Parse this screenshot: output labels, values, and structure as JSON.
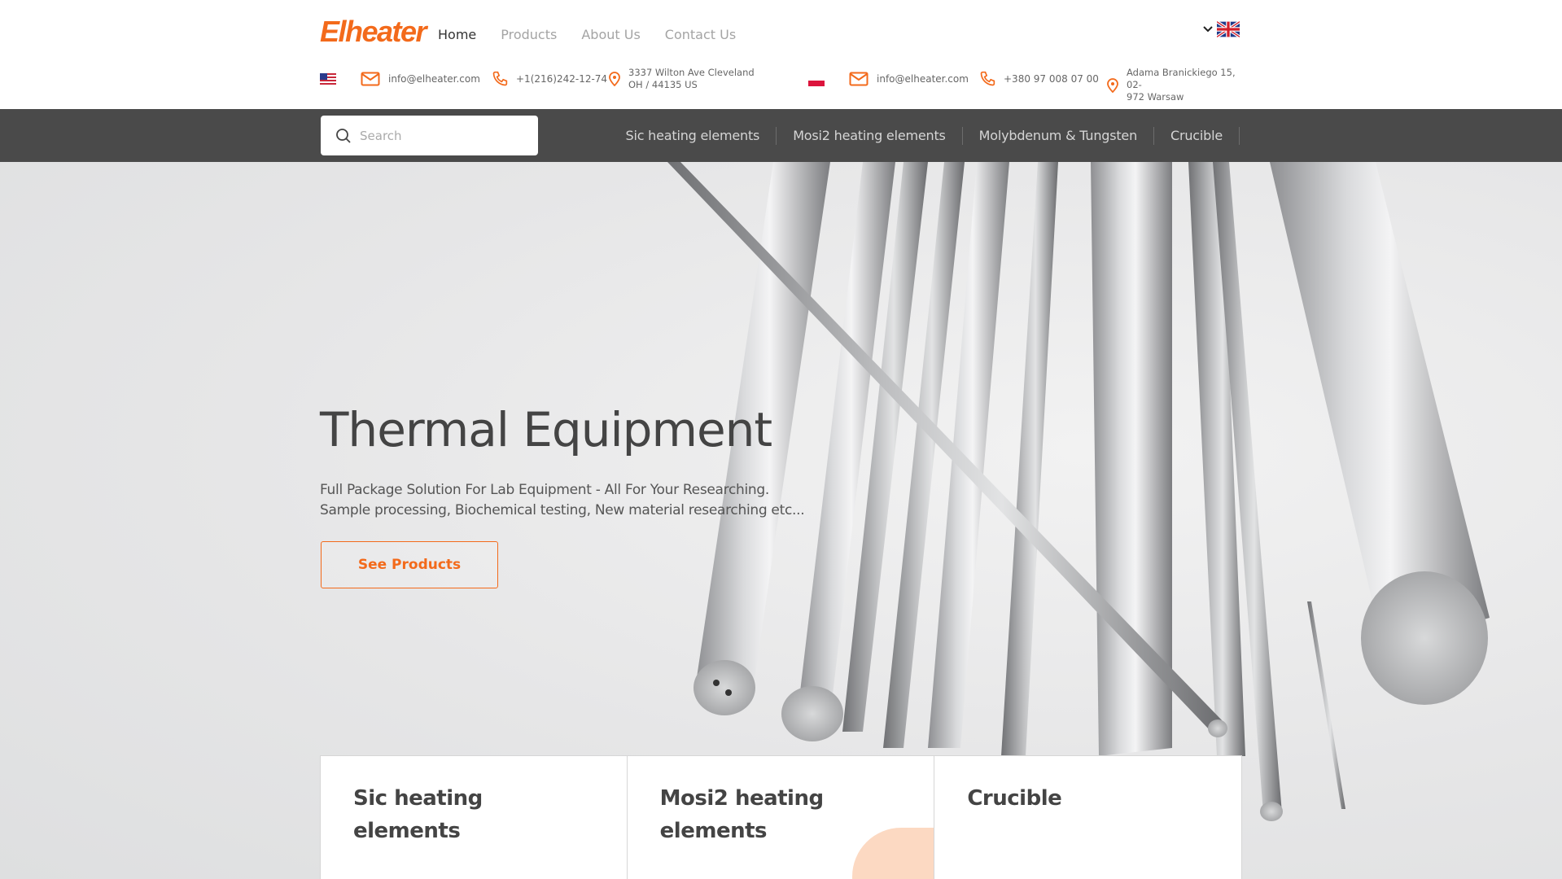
{
  "brand": {
    "logo_text": "Elheater",
    "accent_color": "#f36a1b"
  },
  "nav": {
    "items": [
      {
        "label": "Home",
        "active": true
      },
      {
        "label": "Products",
        "active": false
      },
      {
        "label": "About Us",
        "active": false
      },
      {
        "label": "Contact Us",
        "active": false
      }
    ],
    "language": {
      "icon": "uk-flag-icon",
      "dropdown_icon": "chevron-down-icon"
    }
  },
  "contacts": {
    "us": {
      "flag_icon": "us-flag-icon",
      "email": "info@elheater.com",
      "phone": "+1(216)242-12-74",
      "address_line1": "3337 Wilton Ave Cleveland",
      "address_line2": "OH / 44135 US"
    },
    "pl": {
      "flag_icon": "poland-flag-icon",
      "email": "info@elheater.com",
      "phone": "+380 97 008 07 00",
      "address_line1": "Adama Branickiego 15, 02-",
      "address_line2": "972 Warsaw"
    }
  },
  "search": {
    "placeholder": "Search",
    "value": ""
  },
  "categories": [
    "Sic heating elements",
    "Mosi2 heating elements",
    "Molybdenum & Tungsten",
    "Crucible"
  ],
  "hero": {
    "title": "Thermal Equipment",
    "subtitle": "Full Package Solution For Lab Equipment - All For Your Researching. Sample processing, Biochemical testing, New material researching etc...",
    "button_label": "See Products"
  },
  "cards": [
    {
      "title": "Sic heating elements"
    },
    {
      "title": "Mosi2 heating elements"
    },
    {
      "title": "Crucible"
    }
  ]
}
